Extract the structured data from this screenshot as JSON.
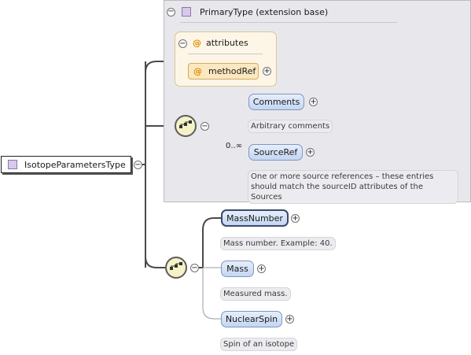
{
  "root": {
    "label": "IsotopeParametersType"
  },
  "extension": {
    "title": "PrimaryType (extension base)",
    "attributes": {
      "label": "attributes",
      "items": [
        {
          "name": "methodRef"
        }
      ]
    },
    "sequence": {
      "elements": [
        {
          "name": "Comments",
          "doc": "Arbitrary comments",
          "cardinality": ""
        },
        {
          "name": "SourceRef",
          "doc_lines": [
            "One or more source references – these entries",
            "should match the sourceID attributes of the Sources"
          ],
          "cardinality": "0..∞"
        }
      ]
    }
  },
  "sequence2": {
    "elements": [
      {
        "name": "MassNumber",
        "doc": "Mass number. Example: 40."
      },
      {
        "name": "Mass",
        "doc": "Measured mass."
      },
      {
        "name": "NuclearSpin",
        "doc": "Spin of an isotope"
      }
    ]
  },
  "icons": {
    "collapse": "minus-circle-icon",
    "expand": "plus-circle-icon",
    "sequence": "sequence-compositor-icon",
    "type": "complex-type-icon",
    "attribute": "attribute-at-icon"
  },
  "colors": {
    "extension_bg": "#e8e8ec",
    "element_fill": "#c4d6f2",
    "attribute_fill": "#fbe8c0",
    "compositor_fill": "#f6f2c8",
    "type_square": "#d8c8ec"
  }
}
